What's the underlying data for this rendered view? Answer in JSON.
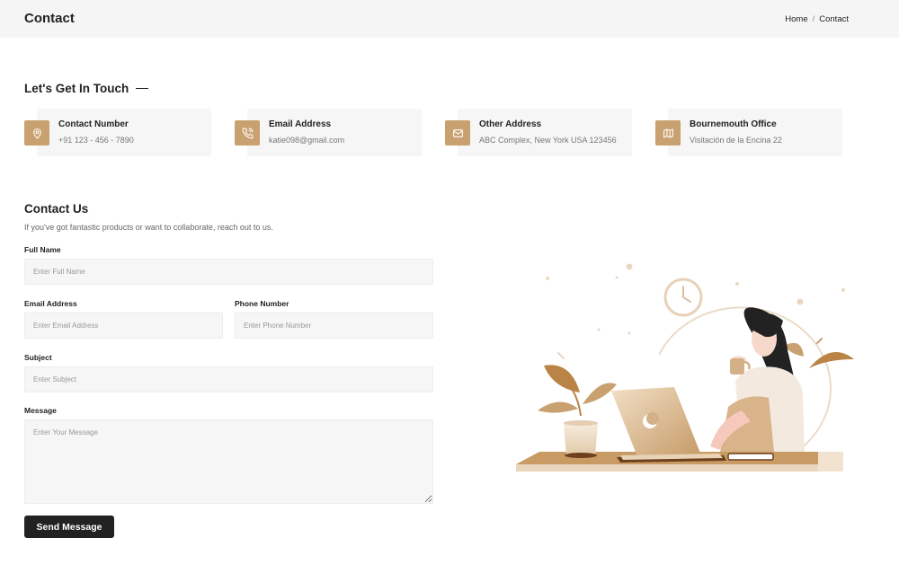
{
  "header": {
    "title": "Contact",
    "breadcrumb": {
      "home": "Home",
      "separator": "/",
      "current": "Contact"
    }
  },
  "touch_section": {
    "heading": "Let's Get In Touch"
  },
  "info_cards": [
    {
      "title": "Contact Number",
      "value": "+91 123 - 456 - 7890",
      "icon": "location-pin-icon"
    },
    {
      "title": "Email Address",
      "value": "katie098@gmail.com",
      "icon": "phone-icon"
    },
    {
      "title": "Other Address",
      "value": "ABC Complex, New York USA 123456",
      "icon": "mail-icon"
    },
    {
      "title": "Bournemouth Office",
      "value": "Visitación de la Encina 22",
      "icon": "map-icon"
    }
  ],
  "form": {
    "title": "Contact Us",
    "subtitle": "If you've got fantastic products or want to collaborate, reach out to us.",
    "full_name": {
      "label": "Full Name",
      "placeholder": "Enter Full Name",
      "value": ""
    },
    "email": {
      "label": "Email Address",
      "placeholder": "Enter Email Address",
      "value": ""
    },
    "phone": {
      "label": "Phone Number",
      "placeholder": "Enter Phone Number",
      "value": ""
    },
    "subject": {
      "label": "Subject",
      "placeholder": "Enter Subject",
      "value": ""
    },
    "message": {
      "label": "Message",
      "placeholder": "Enter Your Message",
      "value": ""
    },
    "submit_label": "Send Message"
  },
  "colors": {
    "accent": "#c9a06f",
    "card_bg": "#f6f6f6",
    "button_bg": "#222222",
    "topbar_bg": "#f5f5f5"
  }
}
